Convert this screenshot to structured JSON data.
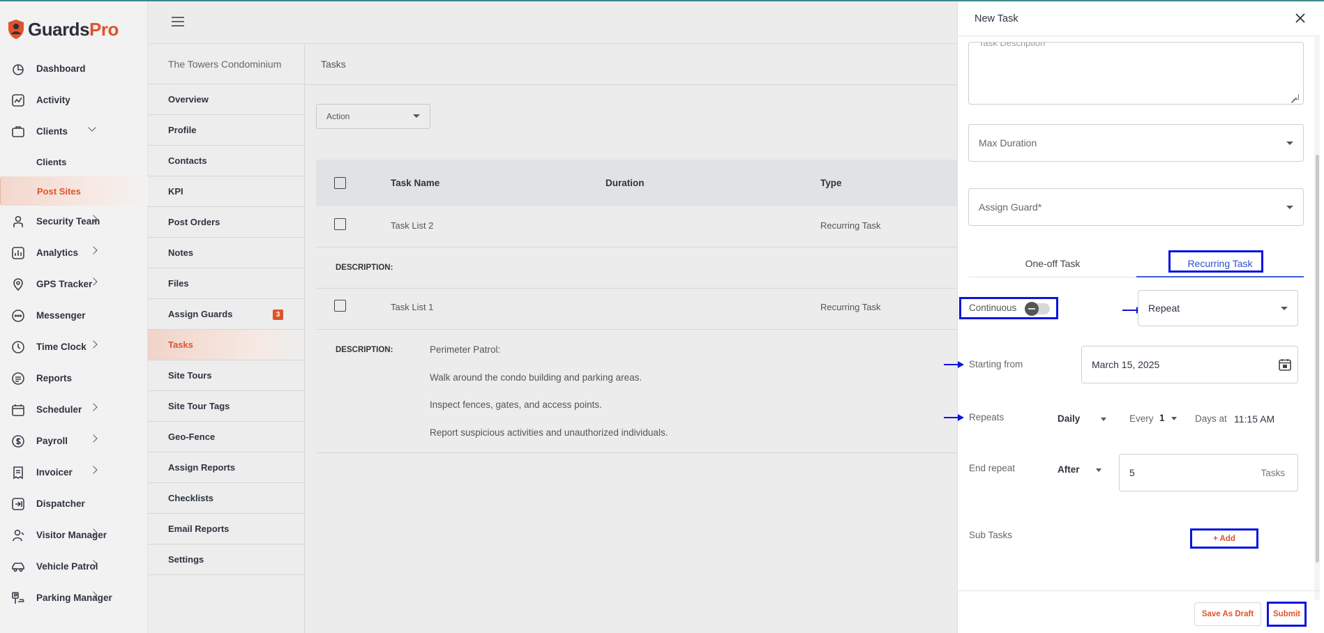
{
  "brand": {
    "part1": "Guards",
    "part2": "Pro"
  },
  "sidebar": {
    "items": [
      {
        "label": "Dashboard",
        "icon": "dashboard-icon"
      },
      {
        "label": "Activity",
        "icon": "activity-icon"
      },
      {
        "label": "Clients",
        "icon": "clients-icon",
        "expanded": true
      },
      {
        "label": "Clients",
        "sub": true
      },
      {
        "label": "Post Sites",
        "sub": true,
        "active": true
      },
      {
        "label": "Security Team",
        "icon": "security-team-icon"
      },
      {
        "label": "Analytics",
        "icon": "analytics-icon"
      },
      {
        "label": "GPS Tracker",
        "icon": "gps-icon"
      },
      {
        "label": "Messenger",
        "icon": "messenger-icon"
      },
      {
        "label": "Time Clock",
        "icon": "clock-icon"
      },
      {
        "label": "Reports",
        "icon": "reports-icon"
      },
      {
        "label": "Scheduler",
        "icon": "calendar-icon"
      },
      {
        "label": "Payroll",
        "icon": "payroll-icon"
      },
      {
        "label": "Invoicer",
        "icon": "invoice-icon"
      },
      {
        "label": "Dispatcher",
        "icon": "dispatcher-icon"
      },
      {
        "label": "Visitor Manager",
        "icon": "visitor-icon"
      },
      {
        "label": "Vehicle Patrol",
        "icon": "car-icon"
      },
      {
        "label": "Parking Manager",
        "icon": "parking-icon"
      }
    ]
  },
  "site": {
    "name": "The Towers Condominium",
    "menu": [
      "Overview",
      "Profile",
      "Contacts",
      "KPI",
      "Post Orders",
      "Notes",
      "Files",
      "Assign Guards",
      "Tasks",
      "Site Tours",
      "Site Tour Tags",
      "Geo-Fence",
      "Assign Reports",
      "Checklists",
      "Email Reports",
      "Settings"
    ],
    "assign_guards_badge": "3"
  },
  "tasks_page": {
    "title": "Tasks",
    "action_label": "Action",
    "columns": [
      "Task Name",
      "Duration",
      "Type"
    ],
    "rows": [
      {
        "name": "Task List 2",
        "duration": "",
        "type": "Recurring Task"
      },
      {
        "name": "Task List 1",
        "duration": "",
        "type": "Recurring Task"
      }
    ],
    "description_label": "DESCRIPTION:",
    "description_lines": [
      "Perimeter Patrol:",
      "Walk around the condo building and parking areas.",
      "Inspect fences, gates, and access points.",
      "Report suspicious activities and unauthorized individuals."
    ]
  },
  "panel": {
    "title": "New Task",
    "task_description_placeholder": "Task Description",
    "max_duration_placeholder": "Max Duration",
    "assign_guard_placeholder": "Assign Guard*",
    "tabs": [
      "One-off Task",
      "Recurring Task"
    ],
    "continuous_label": "Continuous",
    "repeat_select": "Repeat",
    "starting_from_label": "Starting from",
    "starting_date": "March 15, 2025",
    "repeats_label": "Repeats",
    "repeats_freq": "Daily",
    "every_label": "Every",
    "every_value": "1",
    "days_at_label": "Days at",
    "time_value": "11:15 AM",
    "end_repeat_label": "End repeat",
    "end_repeat_mode": "After",
    "end_repeat_count": "5",
    "tasks_suffix": "Tasks",
    "sub_tasks_label": "Sub Tasks",
    "add_label": "+ Add",
    "save_draft_label": "Save As Draft",
    "submit_label": "Submit"
  },
  "colors": {
    "accent": "#e0532a",
    "highlight": "#0b14e0",
    "tab_active": "#2e4fc7"
  }
}
